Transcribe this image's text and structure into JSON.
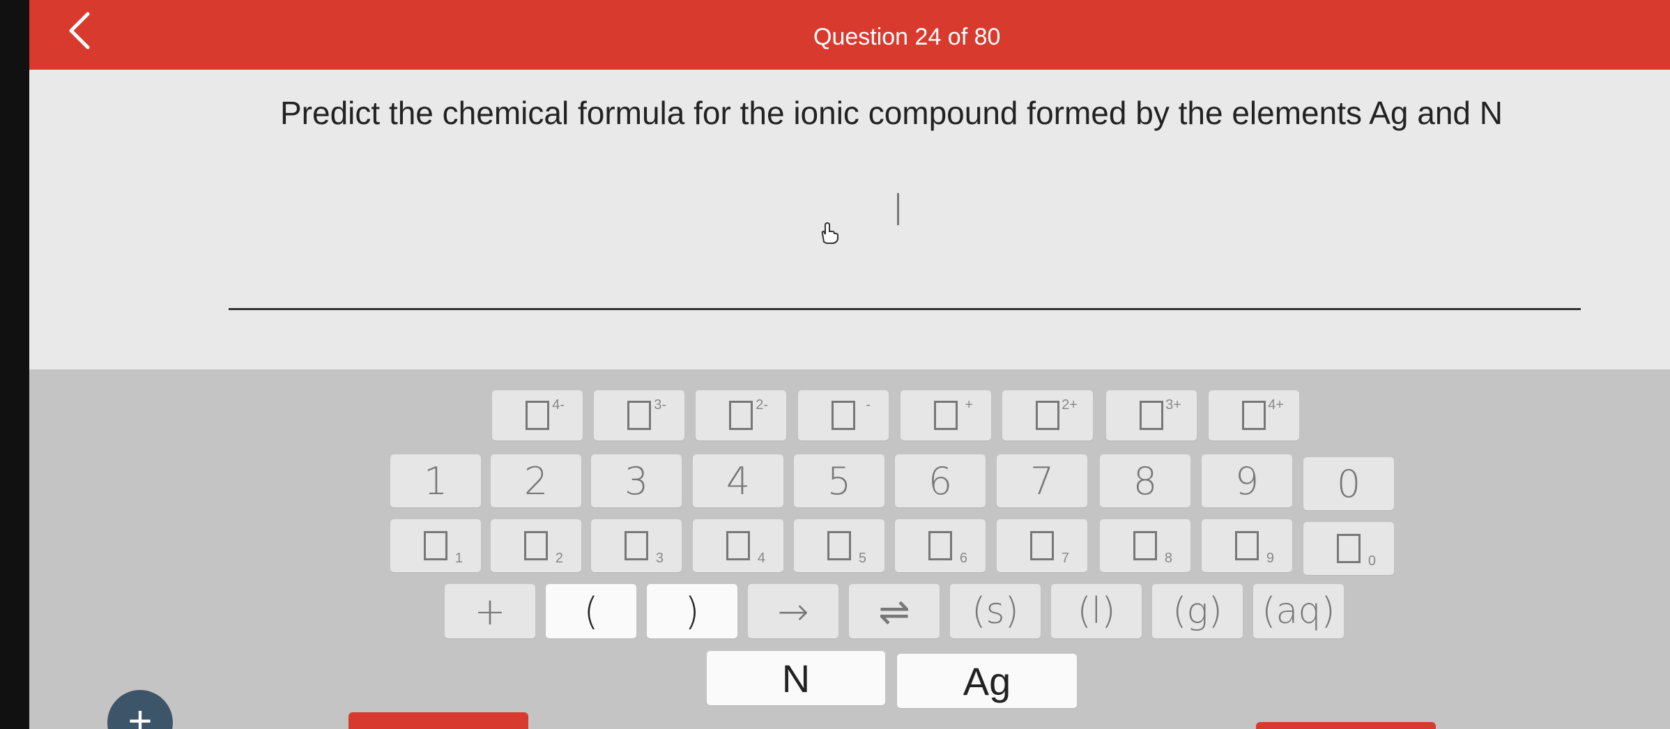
{
  "header": {
    "back_icon": "chevron-left-icon",
    "title": "Question 24 of 80",
    "bg_color": "#d93a2e"
  },
  "question": {
    "text": "Predict the chemical formula for the ionic compound formed by the elements Ag and N",
    "answer_value": ""
  },
  "keypad": {
    "charges": [
      "4-",
      "3-",
      "2-",
      "-",
      "+",
      "2+",
      "3+",
      "4+"
    ],
    "coefficients": [
      "1",
      "2",
      "3",
      "4",
      "5",
      "6",
      "7",
      "8",
      "9",
      "0"
    ],
    "subscripts": [
      "1",
      "2",
      "3",
      "4",
      "5",
      "6",
      "7",
      "8",
      "9",
      "0"
    ],
    "symbols": {
      "plus": "+",
      "open_paren": "(",
      "close_paren": ")",
      "arrow": "→",
      "equilibrium": "⇌",
      "solid": "(s)",
      "liquid": "(l)",
      "gas": "(g)",
      "aqueous": "(aq)"
    },
    "elements": [
      "N",
      "Ag"
    ]
  },
  "fab": {
    "label": "+",
    "icon": "plus-icon"
  }
}
